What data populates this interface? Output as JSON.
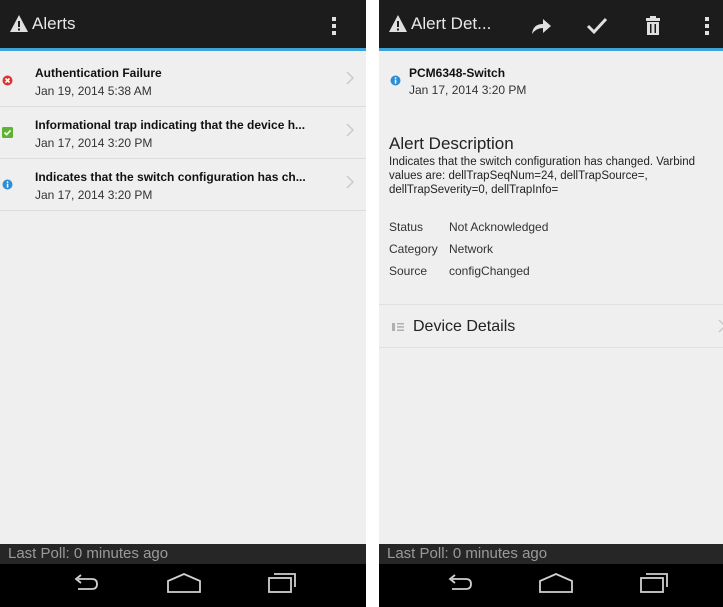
{
  "left_screen": {
    "action_bar": {
      "title": "Alerts"
    },
    "alerts": [
      {
        "title": "Authentication Failure",
        "date": "Jan 19, 2014 5:38 AM",
        "severity_icon": "error-icon",
        "color": "#e0332f"
      },
      {
        "title": "Informational trap indicating that the device h...",
        "date": "Jan 17, 2014 3:20 PM",
        "severity_icon": "check-icon",
        "color": "#5fb334"
      },
      {
        "title": "Indicates that the switch configuration has ch...",
        "date": "Jan 17, 2014 3:20 PM",
        "severity_icon": "info-icon",
        "color": "#2a8fd6"
      }
    ],
    "poll_status": "Last Poll: 0 minutes ago"
  },
  "right_screen": {
    "action_bar": {
      "title": "Alert Det..."
    },
    "device_name": "PCM6348-Switch",
    "date": "Jan 17, 2014 3:20 PM",
    "description_heading": "Alert Description",
    "description": "Indicates that the switch configuration has changed. Varbind values are: dellTrapSeqNum=24, dellTrapSource=, dellTrapSeverity=0, dellTrapInfo=",
    "fields": [
      {
        "label": "Status",
        "value": "Not Acknowledged"
      },
      {
        "label": "Category",
        "value": "Network"
      },
      {
        "label": "Source",
        "value": "configChanged"
      }
    ],
    "section_label": "Device Details",
    "poll_status": "Last Poll: 0 minutes ago"
  },
  "colors": {
    "accent": "#3ea3d8",
    "action_bar": "#1c1c1c",
    "background": "#efefef"
  }
}
